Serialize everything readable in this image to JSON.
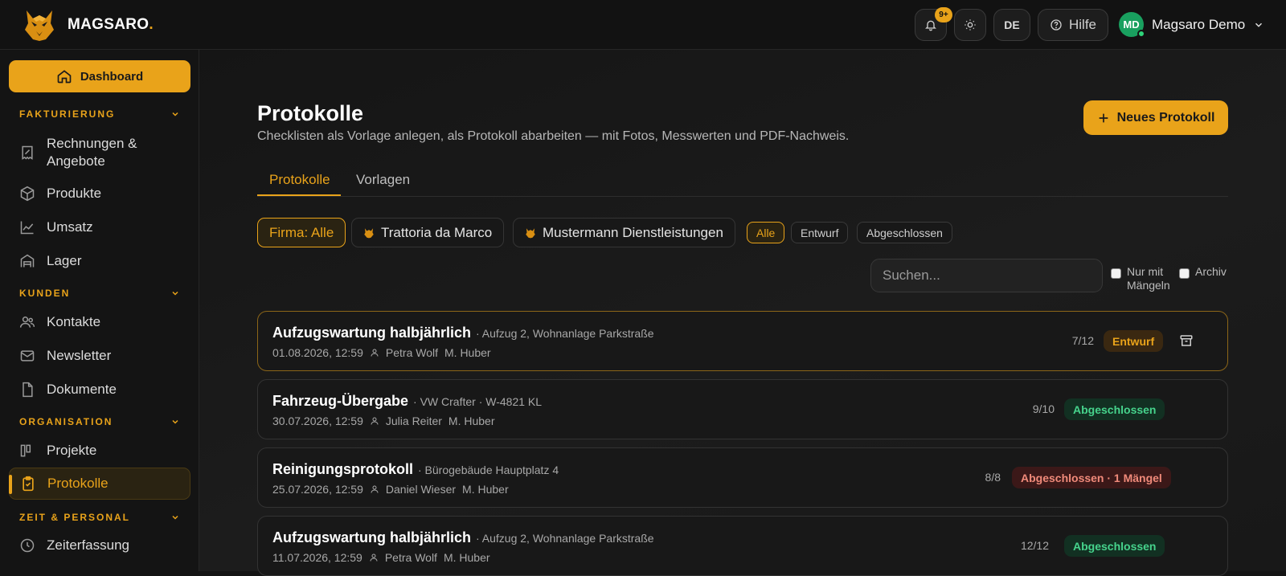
{
  "header": {
    "brand": "MAGSARO",
    "brand_dot": ".",
    "notif_badge": "9+",
    "lang": "DE",
    "help_label": "Hilfe",
    "user_initials": "MD",
    "user_name": "Magsaro Demo"
  },
  "sidebar": {
    "dashboard_label": "Dashboard",
    "sections": [
      {
        "title": "FAKTURIERUNG",
        "items": [
          "Rechnungen & Angebote",
          "Produkte",
          "Umsatz",
          "Lager"
        ]
      },
      {
        "title": "KUNDEN",
        "items": [
          "Kontakte",
          "Newsletter",
          "Dokumente"
        ]
      },
      {
        "title": "ORGANISATION",
        "items": [
          "Projekte",
          "Protokolle"
        ]
      },
      {
        "title": "ZEIT & PERSONAL",
        "items": [
          "Zeiterfassung"
        ]
      }
    ],
    "active_item": "Protokolle"
  },
  "page": {
    "title": "Protokolle",
    "subtitle": "Checklisten als Vorlage anlegen, als Protokoll abarbeiten — mit Fotos, Messwerten und PDF-Nachweis.",
    "new_button": "Neues Protokoll",
    "tabs": [
      "Protokolle",
      "Vorlagen"
    ],
    "active_tab": "Protokolle"
  },
  "filters": {
    "companies": [
      "Firma: Alle",
      "Trattoria da Marco",
      "Mustermann Dienstleistungen"
    ],
    "status": [
      "Alle",
      "Entwurf",
      "Abgeschlossen"
    ],
    "search_placeholder": "Suchen...",
    "only_defects_label": "Nur mit Mängeln",
    "archive_label": "Archiv"
  },
  "protocols": [
    {
      "title": "Aufzugswartung halbjährlich",
      "subtitle": "· Aufzug 2, Wohnanlage Parkstraße",
      "date": "01.08.2026, 12:59",
      "person": "Petra Wolf",
      "manager": "M. Huber",
      "count": "7/12",
      "status": "Entwurf",
      "status_kind": "draft"
    },
    {
      "title": "Fahrzeug-Übergabe",
      "subtitle": "· VW Crafter · W-4821 KL",
      "date": "30.07.2026, 12:59",
      "person": "Julia Reiter",
      "manager": "M. Huber",
      "count": "9/10",
      "status": "Abgeschlossen",
      "status_kind": "done"
    },
    {
      "title": "Reinigungsprotokoll",
      "subtitle": "· Bürogebäude Hauptplatz 4",
      "date": "25.07.2026, 12:59",
      "person": "Daniel Wieser",
      "manager": "M. Huber",
      "count": "8/8",
      "status": "Abgeschlossen · 1 Mängel",
      "status_kind": "error"
    },
    {
      "title": "Aufzugswartung halbjährlich",
      "subtitle": "· Aufzug 2, Wohnanlage Parkstraße",
      "date": "11.07.2026, 12:59",
      "person": "Petra Wolf",
      "manager": "M. Huber",
      "count": "12/12",
      "status": "Abgeschlossen",
      "status_kind": "done"
    }
  ],
  "colors": {
    "accent": "#e9a31a",
    "success": "#46d38c",
    "danger": "#f08a7a"
  }
}
